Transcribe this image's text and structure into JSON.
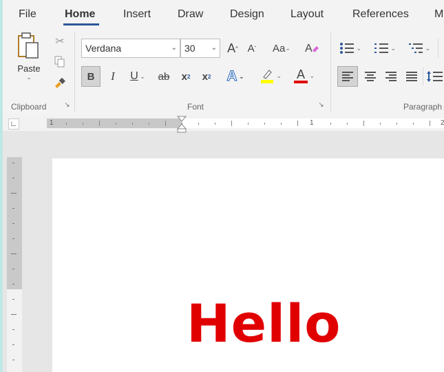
{
  "tabs": [
    "File",
    "Home",
    "Insert",
    "Draw",
    "Design",
    "Layout",
    "References",
    "M"
  ],
  "clipboard": {
    "paste_label": "Paste",
    "group_label": "Clipboard"
  },
  "font": {
    "family": "Verdana",
    "size": "30",
    "grow_label": "A",
    "shrink_label": "A",
    "case_label": "Aa",
    "bold": "B",
    "italic": "I",
    "underline": "U",
    "strike": "ab",
    "subscript": "x",
    "superscript": "x",
    "effects": "A",
    "font_color": "A",
    "group_label": "Font"
  },
  "paragraph": {
    "group_label": "Paragraph"
  },
  "ruler": {
    "labels": [
      "1",
      "1",
      "2"
    ]
  },
  "document": {
    "text": "Hello",
    "color": "#e10000"
  },
  "colors": {
    "accent": "#2b579a",
    "highlight": "#ffff00",
    "font_color_bar": "#e00000"
  }
}
